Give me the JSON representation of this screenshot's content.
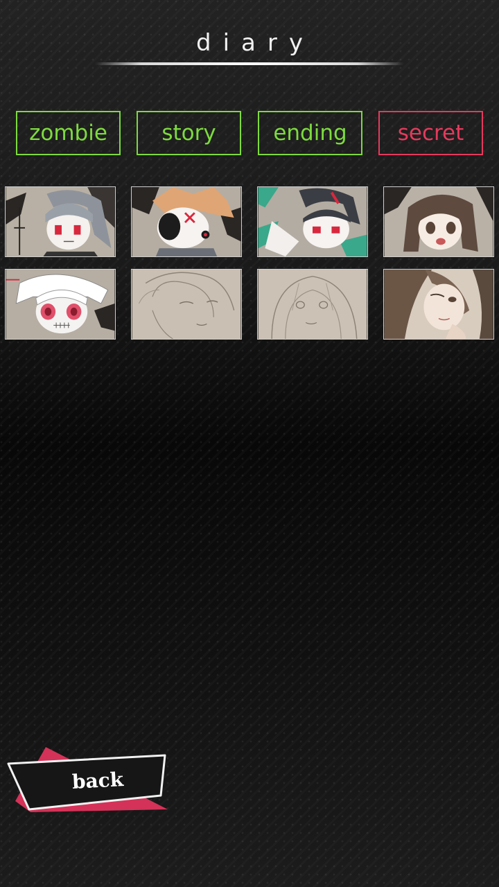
{
  "header": {
    "title": "diary"
  },
  "tabs": [
    {
      "label": "zombie",
      "color": "#7ddb3e"
    },
    {
      "label": "story",
      "color": "#7ddb3e"
    },
    {
      "label": "ending",
      "color": "#7ddb3e"
    },
    {
      "label": "secret",
      "color": "#e53a5c"
    }
  ],
  "entries": [
    {
      "icon": "character-grey-hair-zombie-thumbnail"
    },
    {
      "icon": "character-orange-hair-masked-thumbnail"
    },
    {
      "icon": "character-dark-hair-bandaged-thumbnail"
    },
    {
      "icon": "character-brown-hair-girl-thumbnail"
    },
    {
      "icon": "character-white-hair-zombie-thumbnail"
    },
    {
      "icon": "sketch-smiling-boy-thumbnail"
    },
    {
      "icon": "sketch-long-hair-girl-thumbnail"
    },
    {
      "icon": "character-brown-hair-resting-thumbnail"
    }
  ],
  "footer": {
    "back_label": "back"
  },
  "colors": {
    "accent_green": "#7ddb3e",
    "accent_red": "#e53a5c",
    "background": "#141414"
  }
}
